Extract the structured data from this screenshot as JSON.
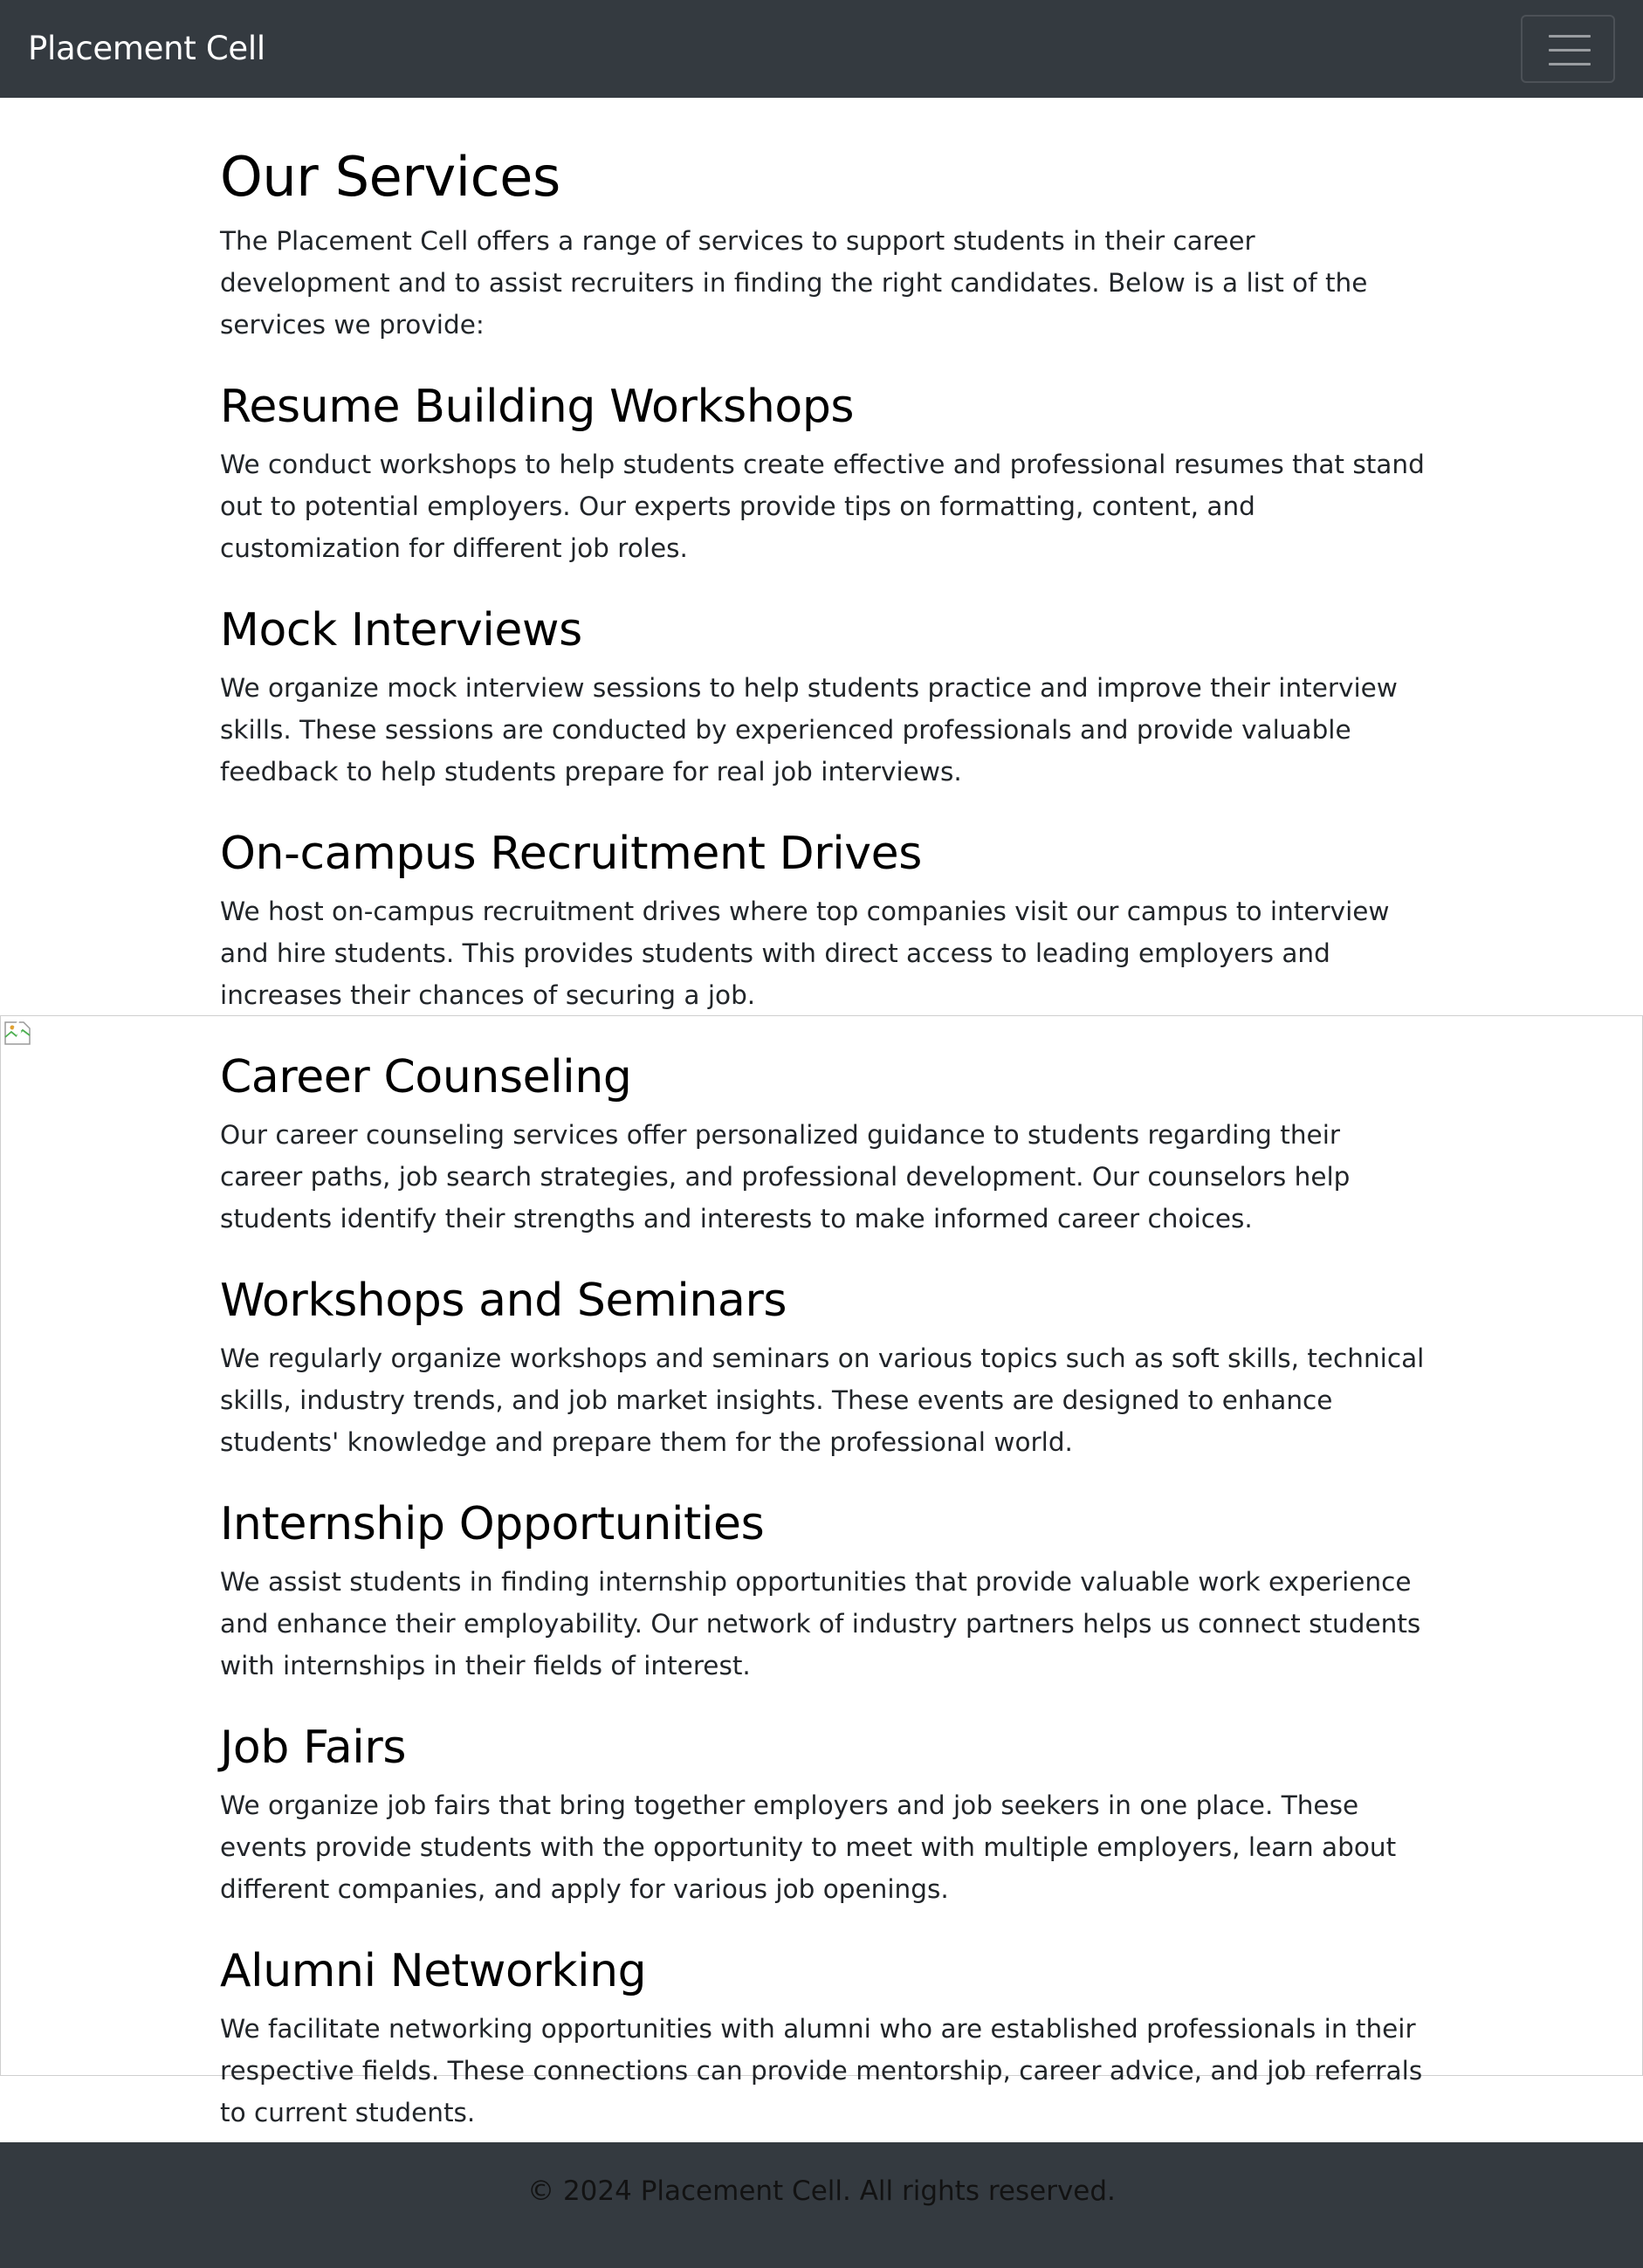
{
  "navbar": {
    "brand": "Placement Cell",
    "toggler_icon": "hamburger-menu-icon"
  },
  "main": {
    "title": "Our Services",
    "intro": "The Placement Cell offers a range of services to support students in their career development and to assist recruiters in finding the right candidates. Below is a list of the services we provide:",
    "services": [
      {
        "heading": "Resume Building Workshops",
        "body": "We conduct workshops to help students create effective and professional resumes that stand out to potential employers. Our experts provide tips on formatting, content, and customization for different job roles."
      },
      {
        "heading": "Mock Interviews",
        "body": "We organize mock interview sessions to help students practice and improve their interview skills. These sessions are conducted by experienced professionals and provide valuable feedback to help students prepare for real job interviews."
      },
      {
        "heading": "On-campus Recruitment Drives",
        "body": "We host on-campus recruitment drives where top companies visit our campus to interview and hire students. This provides students with direct access to leading employers and increases their chances of securing a job."
      },
      {
        "heading": "Career Counseling",
        "body": "Our career counseling services offer personalized guidance to students regarding their career paths, job search strategies, and professional development. Our counselors help students identify their strengths and interests to make informed career choices."
      },
      {
        "heading": "Workshops and Seminars",
        "body": "We regularly organize workshops and seminars on various topics such as soft skills, technical skills, industry trends, and job market insights. These events are designed to enhance students' knowledge and prepare them for the professional world."
      },
      {
        "heading": "Internship Opportunities",
        "body": "We assist students in finding internship opportunities that provide valuable work experience and enhance their employability. Our network of industry partners helps us connect students with internships in their fields of interest."
      },
      {
        "heading": "Job Fairs",
        "body": "We organize job fairs that bring together employers and job seekers in one place. These events provide students with the opportunity to meet with multiple employers, learn about different companies, and apply for various job openings."
      },
      {
        "heading": "Alumni Networking",
        "body": "We facilitate networking opportunities with alumni who are established professionals in their respective fields. These connections can provide mentorship, career advice, and job referrals to current students."
      }
    ]
  },
  "broken_image_icon": "broken-image-icon",
  "footer": {
    "text": "© 2024 Placement Cell. All rights reserved."
  },
  "colors": {
    "navbar_bg": "#343a40",
    "footer_bg": "#343a40",
    "brand_text": "#ffffff",
    "heading_text": "#000000",
    "body_text": "#212529"
  }
}
